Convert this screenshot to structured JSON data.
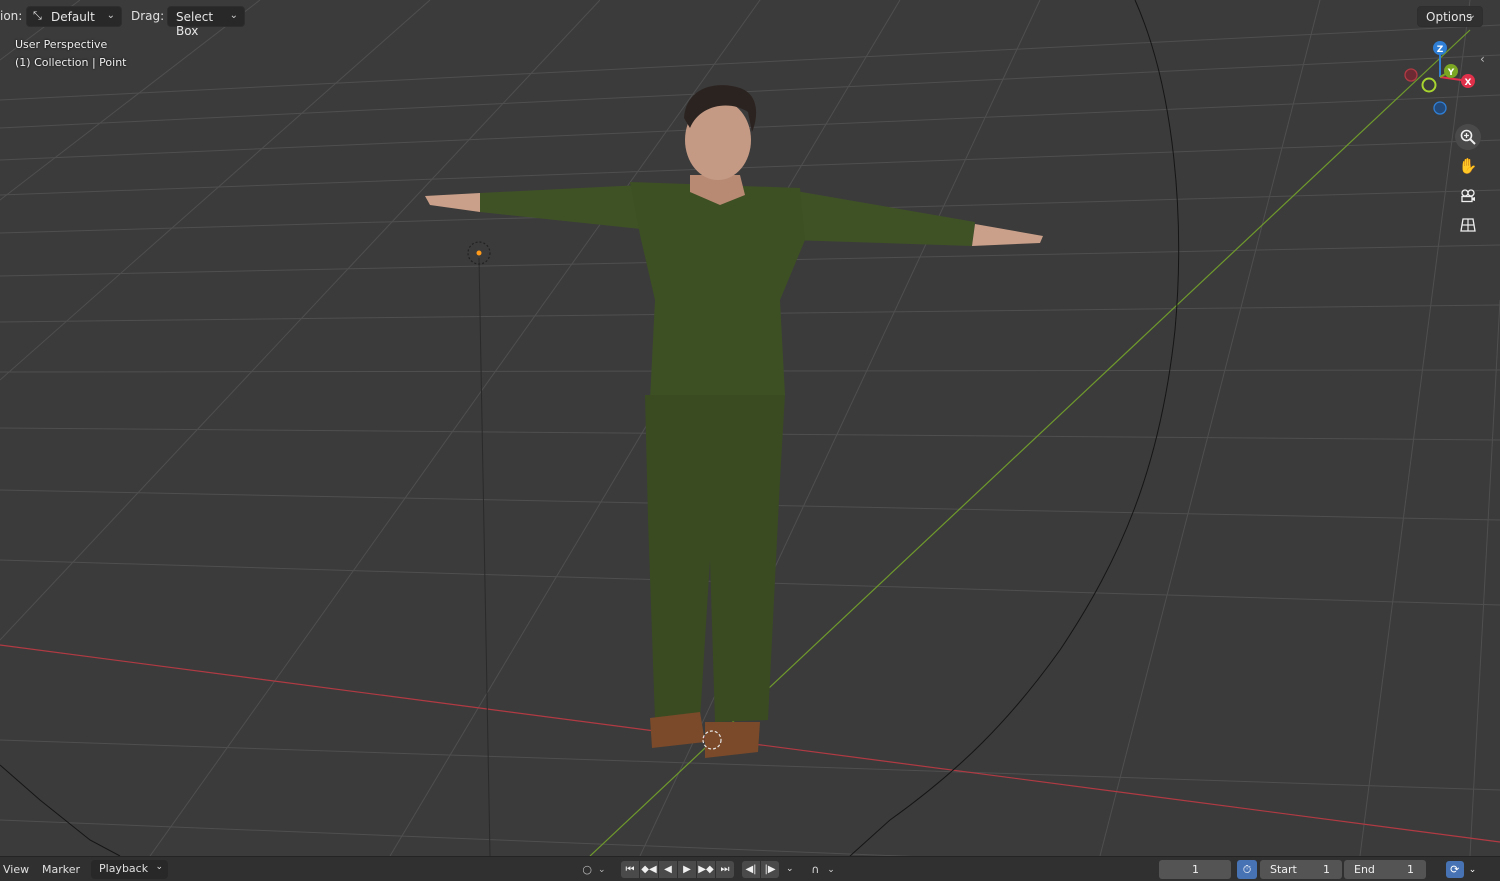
{
  "header": {
    "orientation_label_partial": "ion:",
    "orientation_value": "Default",
    "drag_label": "Drag:",
    "drag_value": "Select Box",
    "options_label": "Options"
  },
  "viewport_overlay": {
    "perspective": "User Perspective",
    "collection": "(1) Collection | Point"
  },
  "gizmo": {
    "axes": [
      "Z",
      "Y",
      "X"
    ],
    "colors": {
      "x": "#e0304a",
      "y": "#7ba623",
      "z": "#2f7fd6",
      "grid_x_line": "#b13a43",
      "grid_y_line": "#6f9a2c",
      "grid": "#505050",
      "background": "#3b3b3b"
    }
  },
  "nav_icons": [
    "zoom-icon",
    "pan-hand-icon",
    "camera-view-icon",
    "ortho-grid-icon"
  ],
  "timeline": {
    "view_label": "View",
    "marker_label": "Marker",
    "playback_label": "Playback",
    "current_frame": "1",
    "start_label": "Start",
    "start_value": "1",
    "end_label": "End",
    "end_value": "1"
  }
}
